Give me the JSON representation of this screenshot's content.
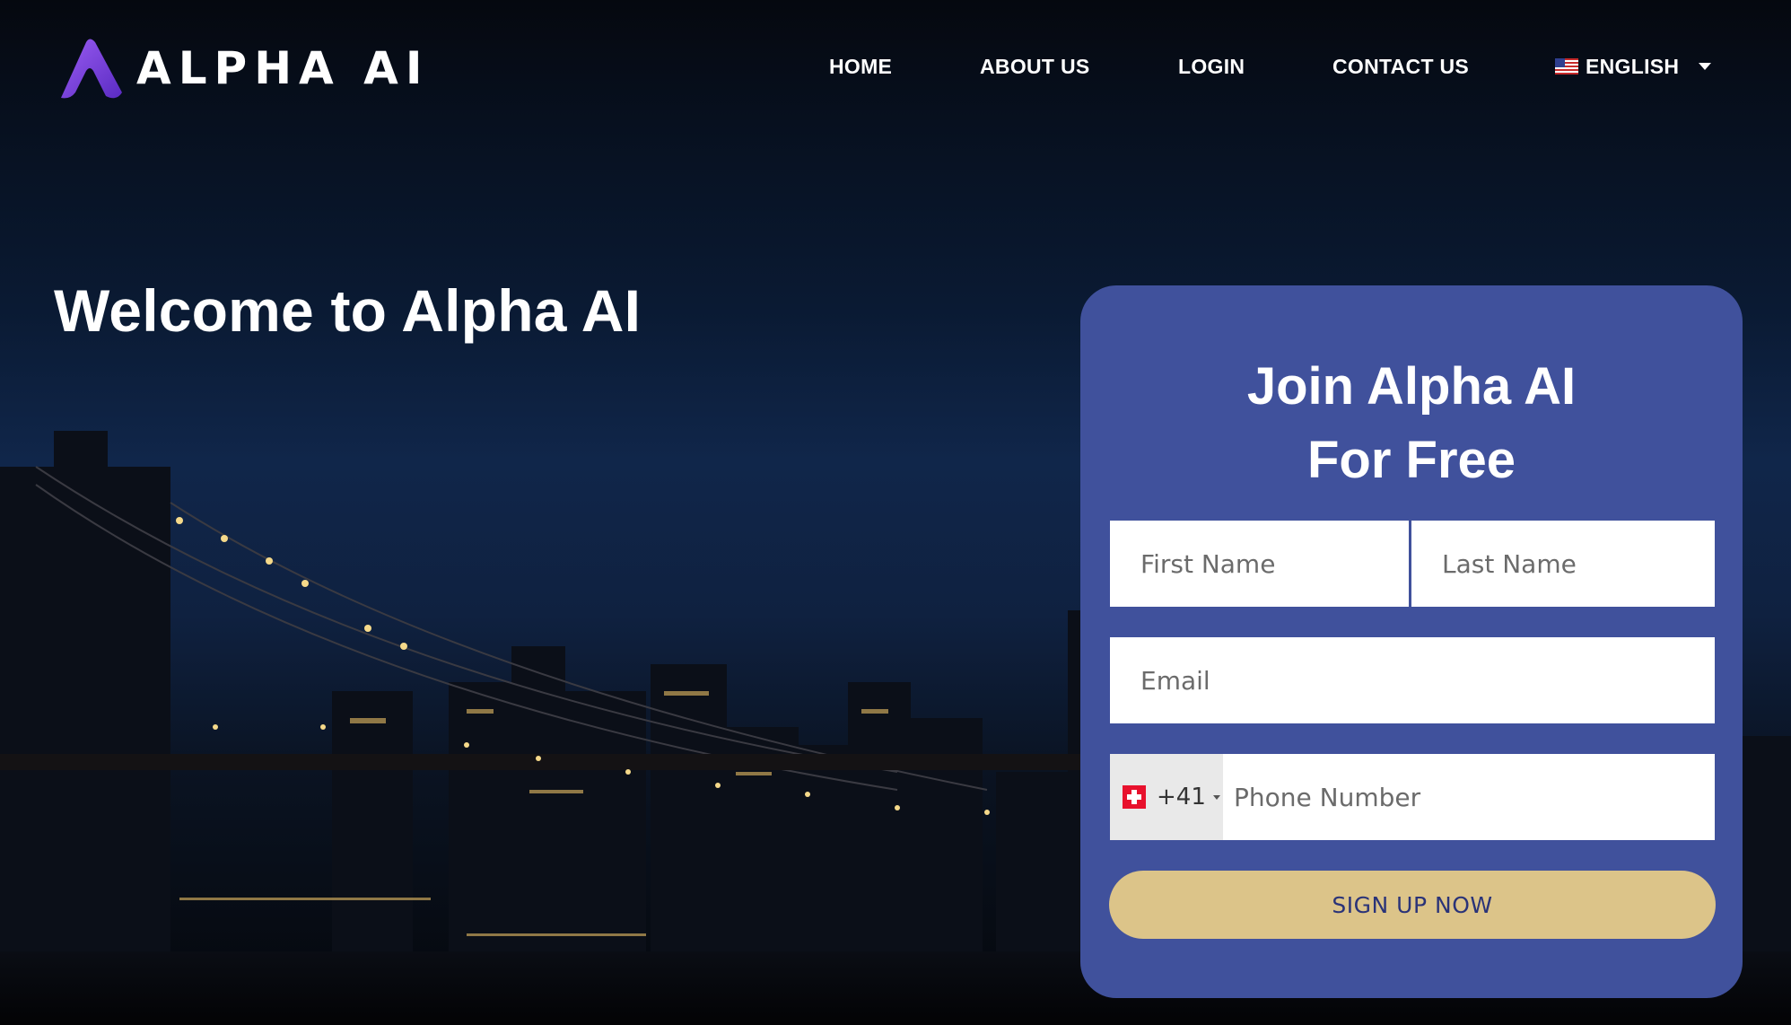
{
  "brand": {
    "name": "ALPHA AI",
    "accent": "#7b3fe4"
  },
  "nav": {
    "items": [
      {
        "label": "HOME"
      },
      {
        "label": "ABOUT US"
      },
      {
        "label": "LOGIN"
      },
      {
        "label": "CONTACT US"
      }
    ],
    "language": "ENGLISH"
  },
  "hero": {
    "heading": "Welcome to Alpha AI"
  },
  "signup": {
    "title_line1": "Join Alpha AI",
    "title_line2": "For Free",
    "first_name_placeholder": "First Name",
    "last_name_placeholder": "Last Name",
    "email_placeholder": "Email",
    "phone_country_code": "+41",
    "phone_placeholder": "Phone Number",
    "submit_label": "SIGN UP NOW",
    "card_color": "#40519c",
    "button_color": "#dcc489"
  }
}
